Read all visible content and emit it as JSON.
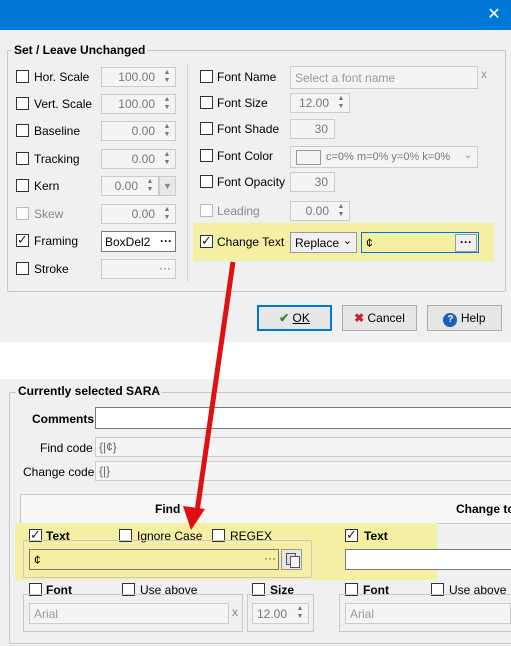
{
  "dialog": {
    "close_glyph": "✕",
    "group_title": "Set / Leave Unchanged",
    "left_rows": [
      {
        "label": "Hor. Scale",
        "value": "100.00",
        "checked": false,
        "enabled": true
      },
      {
        "label": "Vert. Scale",
        "value": "100.00",
        "checked": false,
        "enabled": true
      },
      {
        "label": "Baseline",
        "value": "0.00",
        "checked": false,
        "enabled": true
      },
      {
        "label": "Tracking",
        "value": "0.00",
        "checked": false,
        "enabled": true
      },
      {
        "label": "Kern",
        "value": "0.00",
        "checked": false,
        "enabled": true
      },
      {
        "label": "Skew",
        "value": "0.00",
        "checked": false,
        "enabled": false
      },
      {
        "label": "Framing",
        "value": "BoxDel2",
        "checked": true,
        "enabled": true
      },
      {
        "label": "Stroke",
        "value": "",
        "checked": false,
        "enabled": true
      }
    ],
    "right_rows": {
      "font_name": {
        "label": "Font Name",
        "placeholder": "Select a font name",
        "clear": "x"
      },
      "font_size": {
        "label": "Font Size",
        "value": "12.00"
      },
      "font_shade": {
        "label": "Font Shade",
        "value": "30"
      },
      "font_color": {
        "label": "Font Color",
        "value": "c=0% m=0% y=0% k=0%"
      },
      "font_opacity": {
        "label": "Font Opacity",
        "value": "30"
      },
      "leading": {
        "label": "Leading",
        "value": "0.00"
      },
      "change_text": {
        "label": "Change Text",
        "mode": "Replace",
        "value": "¢"
      }
    },
    "dots": "···",
    "buttons": {
      "ok": "OK",
      "cancel": "Cancel",
      "help": "Help"
    }
  },
  "sara": {
    "title": "Currently selected SARA",
    "comments_label": "Comments",
    "find_code_label": "Find code",
    "find_code_value": "{|¢}",
    "change_code_label": "Change code",
    "change_code_value": "{|}",
    "find_header": "Find",
    "change_header": "Change to",
    "find": {
      "text_label": "Text",
      "ignore_case": "Ignore Case",
      "regex": "REGEX",
      "value": "¢"
    },
    "change": {
      "text_label": "Text"
    },
    "font_label": "Font",
    "use_above": "Use above",
    "size_label": "Size",
    "font_value": "Arial",
    "size_value": "12.00",
    "clear": "x"
  },
  "colors": {
    "accent": "#0078d7",
    "highlight": "#f5efa4",
    "arrow": "#e01010"
  }
}
